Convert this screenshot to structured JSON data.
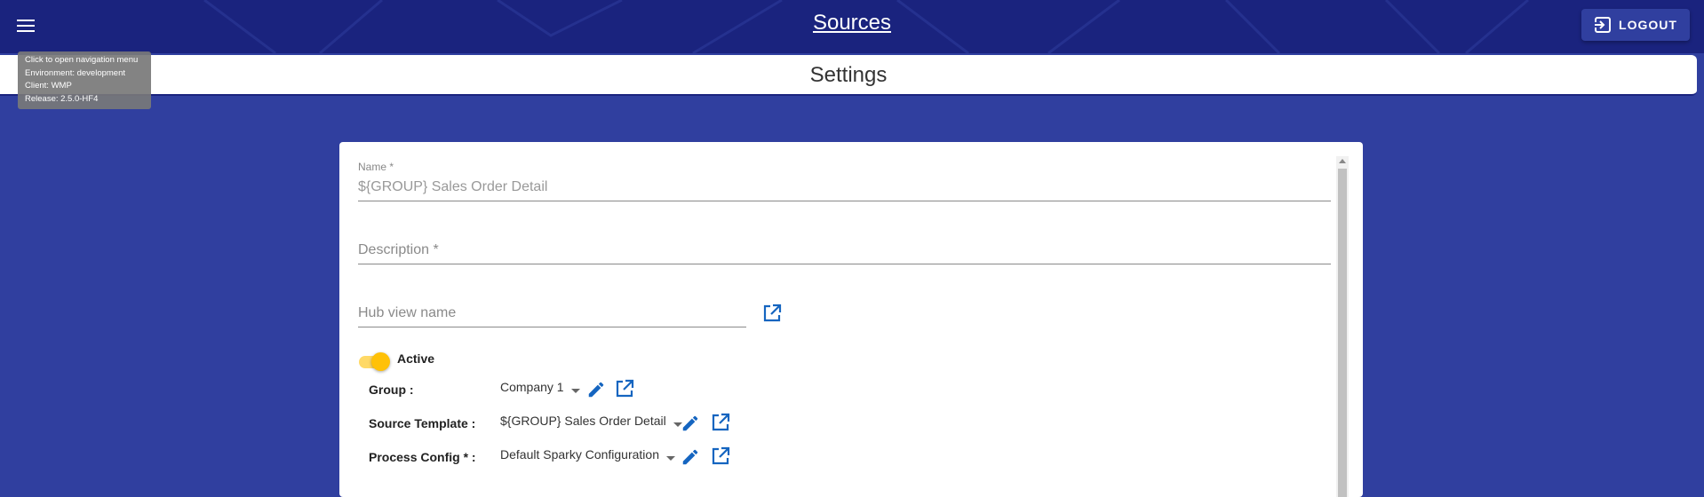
{
  "app": {
    "title": "Sources",
    "logout_label": "LOGOUT"
  },
  "page": {
    "title": "Settings"
  },
  "tooltip": {
    "lines": [
      "Click to open navigation menu",
      "Environment: development",
      "Client: WMP",
      "Release: 2.5.0-HF4"
    ]
  },
  "form": {
    "name": {
      "label": "Name *",
      "value": "${GROUP} Sales Order Detail"
    },
    "description": {
      "placeholder": "Description *"
    },
    "hub_view": {
      "placeholder": "Hub view name"
    },
    "active": {
      "label": "Active",
      "checked": true
    },
    "group": {
      "label": "Group :",
      "value": "Company 1"
    },
    "source_template": {
      "label": "Source Template :",
      "value": "${GROUP} Sales Order Detail"
    },
    "process_config": {
      "label": "Process Config * :",
      "value": "Default Sparky Configuration"
    }
  },
  "icons": {
    "menu": "menu-icon",
    "logout": "logout-icon",
    "edit": "pencil-icon",
    "open": "open-in-new-icon"
  },
  "colors": {
    "appbar": "#1a237e",
    "background": "#303f9f",
    "accent": "#1565c0",
    "toggle": "#ffc107"
  }
}
